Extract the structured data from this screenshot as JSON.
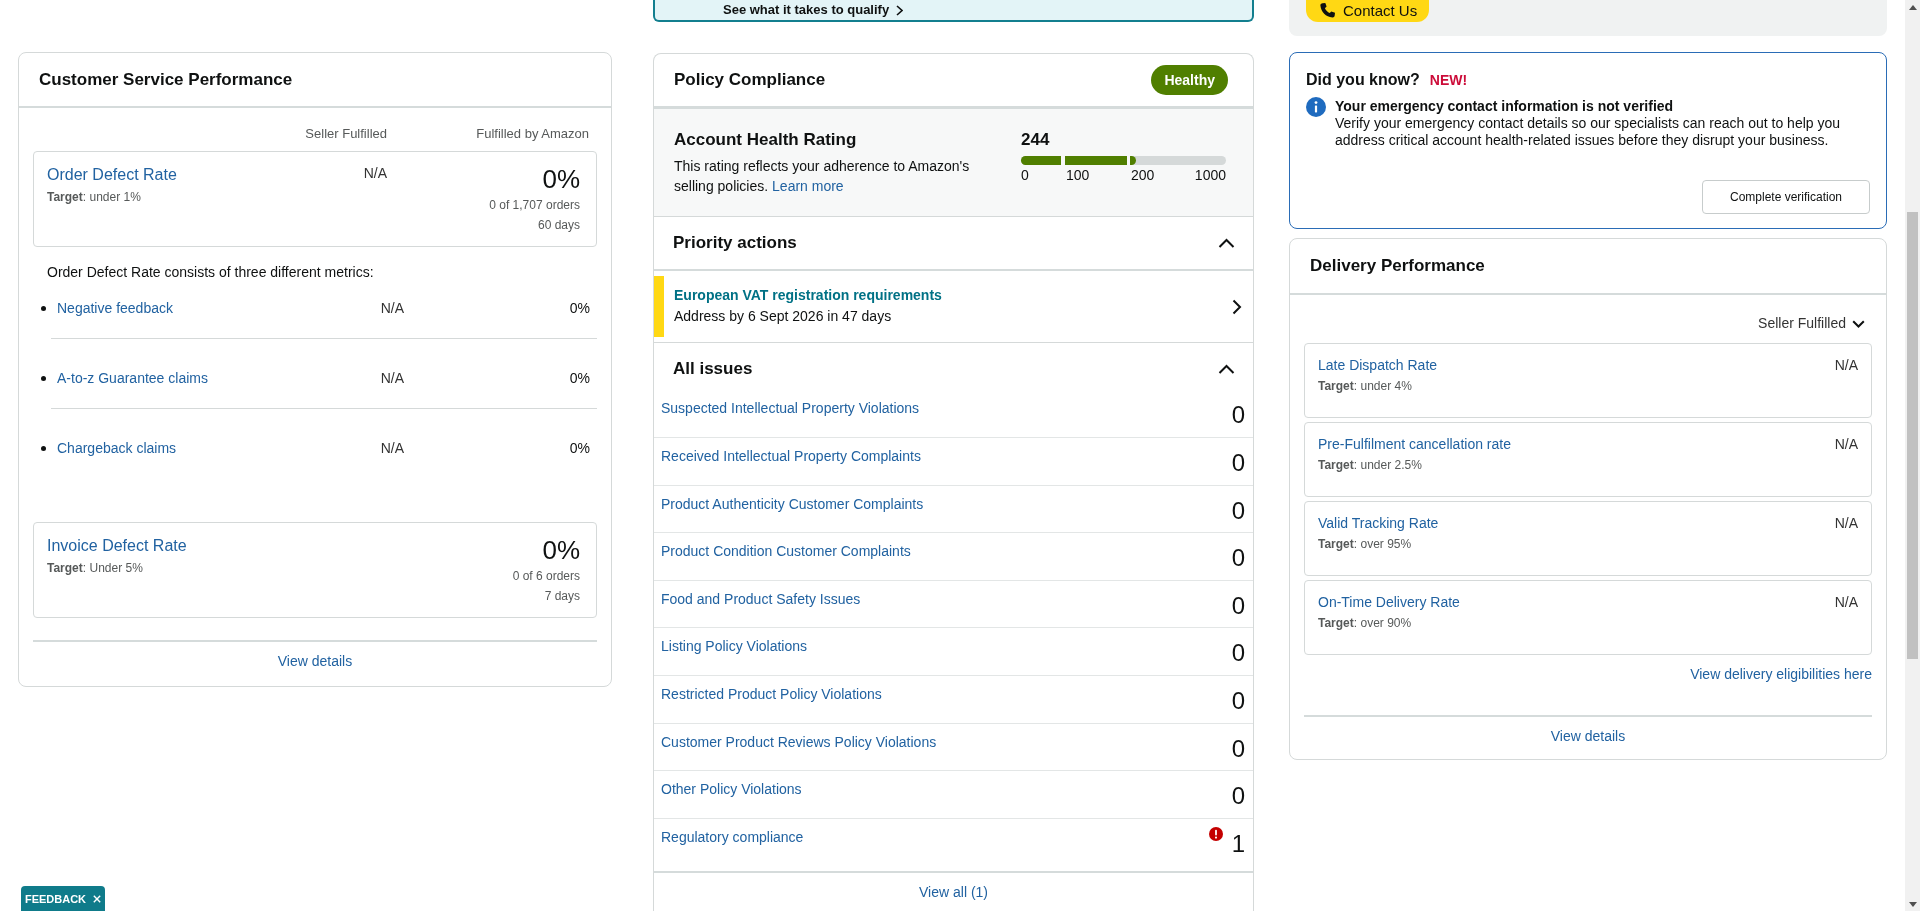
{
  "banner": {
    "link": "See what it takes to qualify"
  },
  "contact": {
    "button": "Contact Us"
  },
  "customer_service": {
    "title": "Customer Service Performance",
    "columns": [
      "Seller Fulfilled",
      "Fulfilled by Amazon"
    ],
    "order_defect_rate": {
      "name": "Order Defect Rate",
      "target": "**Target**: under 1%",
      "seller_value": "N/A",
      "amazon_value": "0%",
      "orders": "0 of 1,707 orders",
      "period": "60 days"
    },
    "breakdown": {
      "intro": "Order Defect Rate consists of three different metrics:",
      "items": [
        {
          "name": "Negative feedback",
          "seller_value": "N/A",
          "amazon_value": "0%"
        },
        {
          "name": "A-to-z Guarantee claims",
          "seller_value": "N/A",
          "amazon_value": "0%"
        },
        {
          "name": "Chargeback claims",
          "seller_value": "N/A",
          "amazon_value": "0%"
        }
      ]
    },
    "invoice_defect_rate": {
      "name": "Invoice Defect Rate",
      "target": "**Target**: Under 5%",
      "amazon_value": "0%",
      "orders": "0 of 6 orders",
      "period": "7 days"
    },
    "view_details": "View details"
  },
  "policy_compliance": {
    "title": "Policy Compliance",
    "status": {
      "label": "Healthy",
      "kind": "healthy"
    },
    "account_health": {
      "title": "Account Health Rating",
      "description": "This rating reflects your adherence to Amazon's selling policies.",
      "link": "Learn more",
      "score": "244",
      "level": 0.56,
      "scale": [
        "0",
        "100",
        "200",
        "1000"
      ]
    },
    "priority_actions": {
      "title": "Priority actions",
      "expanded": true,
      "items": [
        {
          "title": "European VAT registration requirements",
          "subtitle": "Address by 6 Sept 2026 in 47 days"
        }
      ]
    },
    "all_issues": {
      "title": "All issues",
      "expanded": true,
      "items": [
        {
          "name": "Suspected Intellectual Property Violations",
          "count": "0",
          "alert": false
        },
        {
          "name": "Received Intellectual Property Complaints",
          "count": "0",
          "alert": false
        },
        {
          "name": "Product Authenticity Customer Complaints",
          "count": "0",
          "alert": false
        },
        {
          "name": "Product Condition Customer Complaints",
          "count": "0",
          "alert": false
        },
        {
          "name": "Food and Product Safety Issues",
          "count": "0",
          "alert": false
        },
        {
          "name": "Listing Policy Violations",
          "count": "0",
          "alert": false
        },
        {
          "name": "Restricted Product Policy Violations",
          "count": "0",
          "alert": false
        },
        {
          "name": "Customer Product Reviews Policy Violations",
          "count": "0",
          "alert": false
        },
        {
          "name": "Other Policy Violations",
          "count": "0",
          "alert": false
        },
        {
          "name": "Regulatory compliance",
          "count": "1",
          "alert": true
        }
      ],
      "view_all": "View all (1)"
    }
  },
  "did_you_know": {
    "title": "Did you know?",
    "badge": "NEW!",
    "heading": "Your emergency contact information is not verified",
    "body": "Verify your emergency contact details so our specialists can reach out to help you address critical account health-related issues before they disrupt your business.",
    "button": "Complete verification"
  },
  "delivery_performance": {
    "title": "Delivery Performance",
    "filter": "Seller Fulfilled",
    "metrics": [
      {
        "name": "Late Dispatch Rate",
        "target": "**Target**: under 4%",
        "value": "N/A"
      },
      {
        "name": "Pre-Fulfilment cancellation rate",
        "target": "**Target**: under 2.5%",
        "value": "N/A"
      },
      {
        "name": "Valid Tracking Rate",
        "target": "**Target**: over 95%",
        "value": "N/A"
      },
      {
        "name": "On-Time Delivery Rate",
        "target": "**Target**: over 90%",
        "value": "N/A"
      }
    ],
    "eligibility_link": "View delivery eligibilities here",
    "view_details": "View details"
  },
  "feedback": {
    "label": "FEEDBACK"
  }
}
